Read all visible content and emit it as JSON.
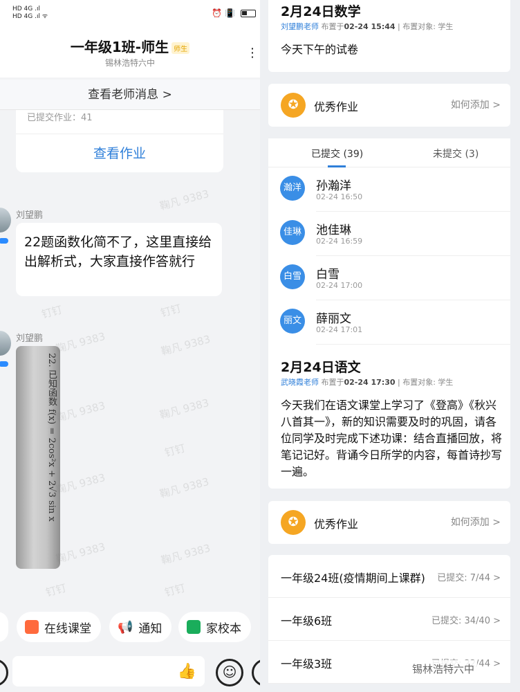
{
  "status": {
    "left_top": "HD 4G .ıl",
    "left_bottom": "HD 4G .ıl ᯤ",
    "right": "⏰ 📳"
  },
  "chat": {
    "title": "一年级1班-师生",
    "title_tag": "师生",
    "subtitle": "锡林浩特六中",
    "teacher_msg": "查看老师消息 >",
    "hw_submitted": "已提交作业：41",
    "hw_view": "查看作业",
    "messages": [
      {
        "sender": "刘望鹏",
        "text": "22题函数化简不了，这里直接给出解析式，大家直接作答就行"
      },
      {
        "sender": "刘望鹏"
      }
    ],
    "image_text": "22. 已知函数 f(x) = 2cos²x + 2√3 sin x",
    "watermarks": [
      "鞠凡 9383",
      "钉钉"
    ],
    "toolbar": [
      "在线课堂",
      "通知",
      "家校本"
    ]
  },
  "detail": {
    "post1": {
      "title": "2月24日数学",
      "teacher": "刘望鹏老师",
      "meta_mid": "布置于",
      "time": "02-24 15:44",
      "meta_tail": "| 布置对象: 学生",
      "body": "今天下午的试卷"
    },
    "excellent_label": "优秀作业",
    "excellent_add": "如何添加 >",
    "tab_submitted": "已提交 (39)",
    "tab_unsubmitted": "未提交 (3)",
    "students": [
      {
        "avatar": "瀚洋",
        "name": "孙瀚洋",
        "time": "02-24 16:50"
      },
      {
        "avatar": "佳琳",
        "name": "池佳琳",
        "time": "02-24 16:59"
      },
      {
        "avatar": "白雪",
        "name": "白雪",
        "time": "02-24 17:00"
      },
      {
        "avatar": "丽文",
        "name": "薛丽文",
        "time": "02-24 17:01"
      }
    ],
    "post2": {
      "title": "2月24日语文",
      "teacher": "武晓霞老师",
      "meta_mid": "布置于",
      "time": "02-24 17:30",
      "meta_tail": "| 布置对象: 学生",
      "body": "今天我们在语文课堂上学习了《登高》《秋兴八首其一》，新的知识需要及时的巩固，请各位同学及时完成下述功课：结合直播回放，将笔记记好。背诵今日所学的内容，每首诗抄写一遍。"
    },
    "classes": [
      {
        "name": "一年级24班(疫情期间上课群)",
        "stat": "已提交: 7/44 >"
      },
      {
        "name": "一年级6班",
        "stat": "已提交: 34/40 >"
      },
      {
        "name": "一年级3班",
        "stat": "已提交: 22/44 >"
      }
    ],
    "footer_watermark": "锡林浩特六中"
  }
}
